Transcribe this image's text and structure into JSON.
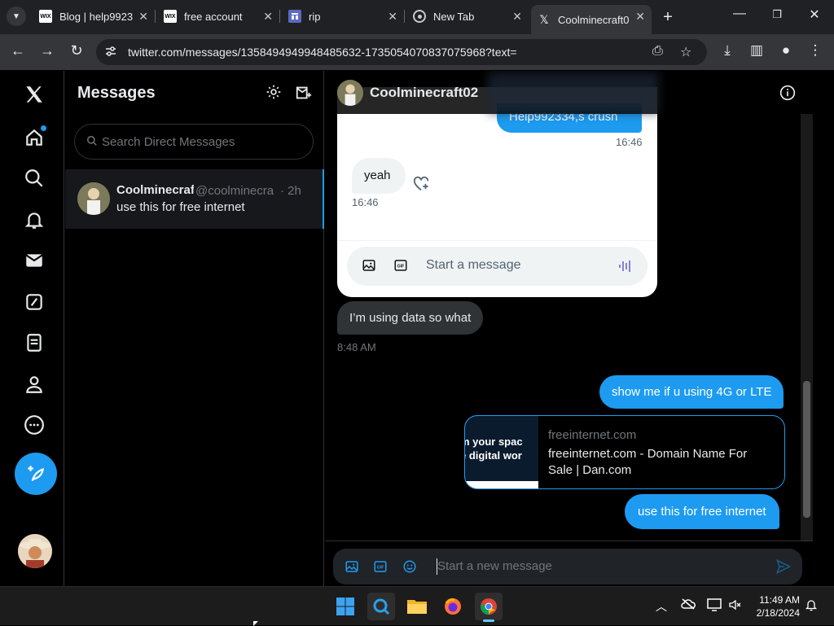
{
  "browser": {
    "tabs": [
      {
        "title": "Blog | help9923",
        "favicon": "WIX"
      },
      {
        "title": "free account",
        "favicon": "WIX"
      },
      {
        "title": "rip",
        "favicon": "form-icon"
      },
      {
        "title": "New Tab",
        "favicon": "chrome-icon"
      },
      {
        "title": "Coolminecraft0",
        "favicon": "x-logo"
      }
    ],
    "url": "twitter.com/messages/1358494949948485632-1735054070837075968?text="
  },
  "sidebar": {
    "nav": [
      "x-logo",
      "home-icon",
      "search-icon",
      "bell-icon",
      "mail-icon",
      "grok-icon",
      "lists-icon",
      "profile-icon",
      "more-icon"
    ],
    "post_icon": "feather-plus-icon"
  },
  "messages": {
    "title": "Messages",
    "search_placeholder": "Search Direct Messages",
    "conversations": [
      {
        "name": "Coolminecraft02",
        "handle": "@coolminecra",
        "time": "· 2h",
        "preview": "use this for free internet"
      }
    ]
  },
  "chat": {
    "name": "Coolminecraft02",
    "screenshot": {
      "out_text": "Help992334,s crush",
      "out_time": "16:46",
      "in_text": "yeah",
      "in_time": "16:46",
      "composer_placeholder": "Start a message"
    },
    "messages": [
      {
        "dir": "in",
        "text": "I’m using data so what",
        "time": "8:48 AM"
      },
      {
        "dir": "out",
        "text": "show me if u using 4G or LTE"
      },
      {
        "dir": "out",
        "text": "use this for free internet"
      }
    ],
    "link_card": {
      "domain": "freeinternet.com",
      "title": "freeinternet.com - Domain Name For Sale | Dan.com",
      "thumb_line1": "m your spac",
      "thumb_line2": "e digital wor"
    },
    "composer_placeholder": "Start a new message"
  },
  "taskbar": {
    "time": "11:49 AM",
    "date": "2/18/2024"
  },
  "colors": {
    "accent": "#1d9bf0",
    "background": "#000000",
    "bubble_in": "#2f3336"
  }
}
